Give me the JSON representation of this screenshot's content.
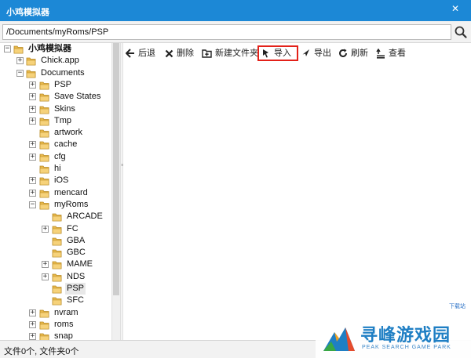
{
  "window": {
    "title": "小鸡模拟器",
    "close_glyph": "✕"
  },
  "path": {
    "value": "/Documents/myRoms/PSP"
  },
  "tree": {
    "items": [
      {
        "label": "小鸡模拟器",
        "expander": "−",
        "level": 0,
        "bold": true
      },
      {
        "label": "Chick.app",
        "expander": "+",
        "level": 1
      },
      {
        "label": "Documents",
        "expander": "−",
        "level": 1
      },
      {
        "label": "PSP",
        "expander": "+",
        "level": 2
      },
      {
        "label": "Save States",
        "expander": "+",
        "level": 2
      },
      {
        "label": "Skins",
        "expander": "+",
        "level": 2
      },
      {
        "label": "Tmp",
        "expander": "+",
        "level": 2
      },
      {
        "label": "artwork",
        "expander": "",
        "level": 2
      },
      {
        "label": "cache",
        "expander": "+",
        "level": 2
      },
      {
        "label": "cfg",
        "expander": "+",
        "level": 2
      },
      {
        "label": "hi",
        "expander": "",
        "level": 2
      },
      {
        "label": "iOS",
        "expander": "+",
        "level": 2
      },
      {
        "label": "mencard",
        "expander": "+",
        "level": 2
      },
      {
        "label": "myRoms",
        "expander": "−",
        "level": 2
      },
      {
        "label": "ARCADE",
        "expander": "",
        "level": 3
      },
      {
        "label": "FC",
        "expander": "+",
        "level": 3
      },
      {
        "label": "GBA",
        "expander": "",
        "level": 3
      },
      {
        "label": "GBC",
        "expander": "",
        "level": 3
      },
      {
        "label": "MAME",
        "expander": "+",
        "level": 3
      },
      {
        "label": "NDS",
        "expander": "+",
        "level": 3
      },
      {
        "label": "PSP",
        "expander": "",
        "level": 3,
        "selected": true
      },
      {
        "label": "SFC",
        "expander": "",
        "level": 3
      },
      {
        "label": "nvram",
        "expander": "+",
        "level": 2
      },
      {
        "label": "roms",
        "expander": "+",
        "level": 2
      },
      {
        "label": "snap",
        "expander": "+",
        "level": 2
      }
    ]
  },
  "toolbar": {
    "back": "后退",
    "delete": "删除",
    "new_folder": "新建文件夹",
    "import": "导入",
    "export": "导出",
    "refresh": "刷新",
    "view": "查看"
  },
  "status": {
    "text": "文件0个, 文件夹0个"
  },
  "watermark": {
    "small": "下载站",
    "name": "寻峰游戏园",
    "sub": "PEAK SEARCH GAME PARK"
  },
  "colors": {
    "titlebar": "#1c88d6",
    "highlight": "#e32119",
    "folder": "#e8b84a"
  }
}
